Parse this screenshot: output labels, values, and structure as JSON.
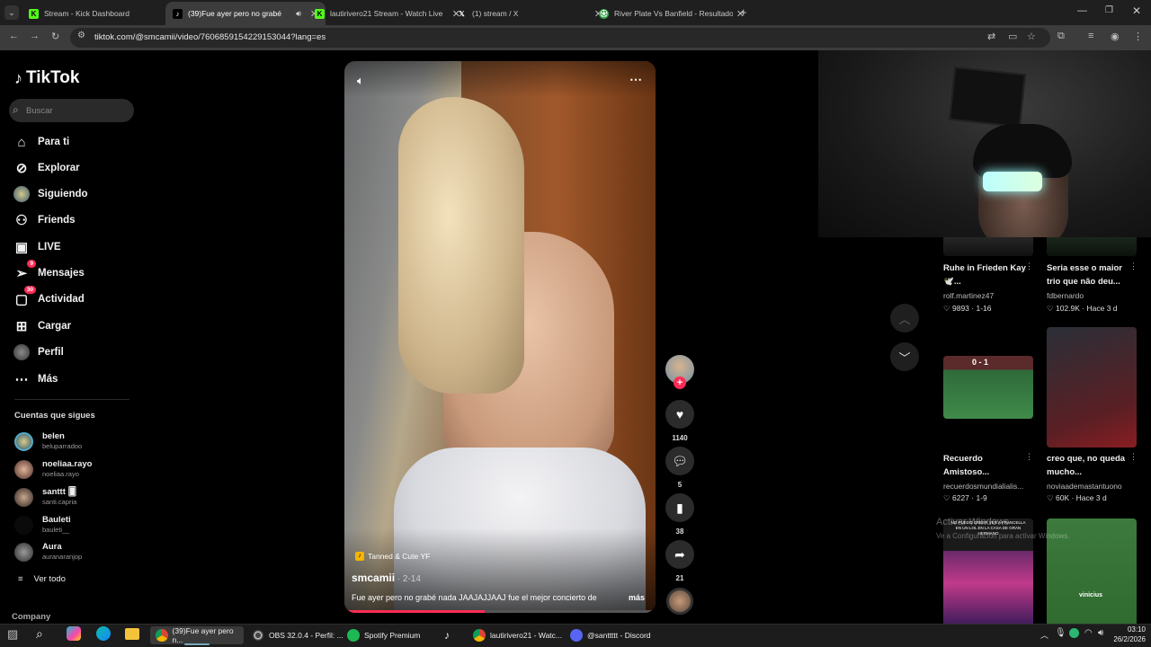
{
  "browser": {
    "tabs": [
      {
        "title": "Stream - Kick Dashboard",
        "icon": "kick-icon",
        "active": false
      },
      {
        "title": "(39)Fue ayer pero no grabé",
        "icon": "tiktok-icon",
        "active": true
      },
      {
        "title": "lautirivero21 Stream - Watch Live",
        "icon": "kick-icon",
        "active": false
      },
      {
        "title": "(1) stream / X",
        "icon": "x-icon",
        "active": false
      },
      {
        "title": "River Plate Vs Banfield - Resultado",
        "icon": "sports-icon",
        "active": false
      }
    ],
    "new_tab": "+",
    "url": "tiktok.com/@smcamii/video/7606859154229153044?lang=es"
  },
  "sidebar": {
    "logo": "TikTok",
    "search_placeholder": "Buscar",
    "nav": [
      {
        "label": "Para ti",
        "icon": "home-icon",
        "badge": ""
      },
      {
        "label": "Explorar",
        "icon": "compass-icon",
        "badge": ""
      },
      {
        "label": "Siguiendo",
        "icon": "following-avatar-icon",
        "badge": ""
      },
      {
        "label": "Friends",
        "icon": "friends-icon",
        "badge": ""
      },
      {
        "label": "LIVE",
        "icon": "live-icon",
        "badge": ""
      },
      {
        "label": "Mensajes",
        "icon": "messages-icon",
        "badge": "9"
      },
      {
        "label": "Actividad",
        "icon": "activity-icon",
        "badge": "30"
      },
      {
        "label": "Cargar",
        "icon": "upload-icon",
        "badge": ""
      },
      {
        "label": "Perfil",
        "icon": "profile-icon",
        "badge": ""
      },
      {
        "label": "Más",
        "icon": "more-icon",
        "badge": ""
      }
    ],
    "following_header": "Cuentas que sigues",
    "following": [
      {
        "name": "belen",
        "handle": "beluparradoo"
      },
      {
        "name": "noeliaa.rayo",
        "handle": "noeliaa.rayo"
      },
      {
        "name": "santtt 🂠",
        "handle": "santi.capria"
      },
      {
        "name": "Bauleti",
        "handle": "bauleti__"
      },
      {
        "name": "Aura",
        "handle": "auranaranjop"
      }
    ],
    "see_all": "Ver todo",
    "company": "Company"
  },
  "video": {
    "music_tag": "Tanned & Cute YF",
    "author": "smcamii",
    "date": " · 2-14",
    "caption": "Fue ayer pero no grabé nada JAAJAJJAAJ fue el mejor concierto de",
    "more": "más",
    "progress": 0.45
  },
  "actions": {
    "likes": "1140",
    "comments": "5",
    "saves": "38",
    "shares": "21"
  },
  "recommended": [
    {
      "title": "Ruhe in Frieden Kay 🕊️...",
      "author": "rolf.martinez47",
      "likes": "9893",
      "date": "1-16"
    },
    {
      "title": "Seria esse o maior trio que não deu...",
      "author": "fdbernardo",
      "likes": "102.9K",
      "date": "Hace 3 d"
    },
    {
      "title": "Recuerdo Amistoso...",
      "author": "recuerdosmundialialis...",
      "likes": "6227",
      "date": "1-9"
    },
    {
      "title": "creo que, no queda mucho...",
      "author": "noviaademastantuono",
      "likes": "60K",
      "date": "Hace 3 d"
    }
  ],
  "thumb_text": {
    "score": "0 - 1",
    "caption_meme": "NO PUEDO CREER VER A FRANCELLA EN UN LOL EN LA CASA DE GRAN HERMANO",
    "player_name": "vinicius"
  },
  "watermark": {
    "line1": "Activar Windows",
    "line2": "Ve a Configuración para activar Windows."
  },
  "taskbar": {
    "items": [
      {
        "label": "(39)Fue ayer pero n...",
        "icon": "chrome-icon"
      },
      {
        "label": "OBS 32.0.4 - Perfil: ...",
        "icon": "obs-icon"
      },
      {
        "label": "Spotify Premium",
        "icon": "spotify-icon"
      },
      {
        "label": "",
        "icon": "tiktok-icon"
      },
      {
        "label": "lautirivero21 - Watc...",
        "icon": "chrome-icon"
      },
      {
        "label": "@santtttt - Discord",
        "icon": "discord-icon"
      }
    ],
    "time": "03:10",
    "date": "26/2/2026"
  },
  "colors": {
    "accent": "#fe2c55",
    "page_bg": "#000000",
    "taskbar_bg": "#1c1c1c"
  }
}
